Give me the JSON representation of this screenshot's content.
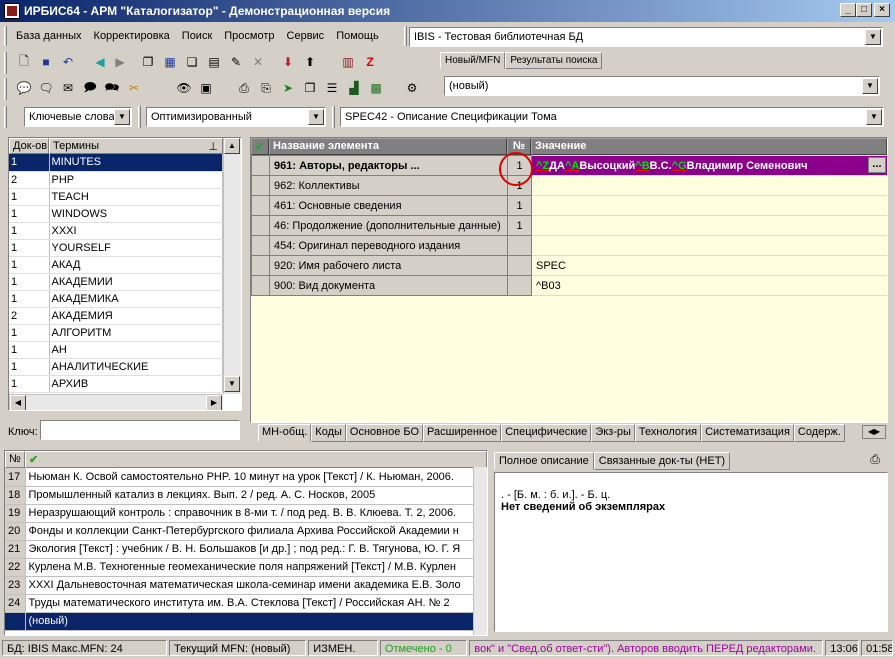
{
  "window": {
    "title": "ИРБИС64 - АРМ \"Каталогизатор\" - Демонстрационная версия",
    "controls": [
      "_",
      "□",
      "×"
    ]
  },
  "menu": [
    "База данных",
    "Корректировка",
    "Поиск",
    "Просмотр",
    "Сервис",
    "Помощь"
  ],
  "db_combo": "IBIS - Тестовая библиотечная БД",
  "right_tabs": [
    "Новый/MFN",
    "Результаты поиска"
  ],
  "record_combo": "(новый)",
  "search_bar": {
    "mode": "Ключевые слова",
    "worksheet": "Оптимизированный",
    "spec": "SPEC42 - Описание Спецификации Тома"
  },
  "terms": {
    "headers": [
      "Док-ов",
      "Термины"
    ],
    "rows": [
      [
        "1",
        "MINUTES"
      ],
      [
        "2",
        "PHP"
      ],
      [
        "1",
        "TEACH"
      ],
      [
        "1",
        "WINDOWS"
      ],
      [
        "1",
        "XXXI"
      ],
      [
        "1",
        "YOURSELF"
      ],
      [
        "1",
        "АКАД"
      ],
      [
        "1",
        "АКАДЕМИИ"
      ],
      [
        "1",
        "АКАДЕМИКА"
      ],
      [
        "2",
        "АКАДЕМИЯ"
      ],
      [
        "1",
        "АЛГОРИТМ"
      ],
      [
        "1",
        "АН"
      ],
      [
        "1",
        "АНАЛИТИЧЕСКИЕ"
      ],
      [
        "1",
        "АРХИВ"
      ]
    ],
    "key_label": "Ключ:",
    "key_value": ""
  },
  "editor": {
    "headers": [
      "Название элемента",
      "№",
      "Значение"
    ],
    "rows": [
      {
        "name": "961: Авторы, редакторы ...",
        "num": "1",
        "value": "",
        "selected": true
      },
      {
        "name": "962: Коллективы",
        "num": "1",
        "value": ""
      },
      {
        "name": "461: Основные сведения",
        "num": "1",
        "value": ""
      },
      {
        "name": "46: Продолжение (дополнительные данные)",
        "num": "1",
        "value": ""
      },
      {
        "name": "454: Оригинал переводного издания",
        "num": "",
        "value": ""
      },
      {
        "name": "920: Имя рабочего листа",
        "num": "",
        "value": "SPEC"
      },
      {
        "name": "900: Вид документа",
        "num": "",
        "value": "^B03"
      }
    ],
    "selected_value_parts": [
      {
        "text": "^Z",
        "hl": true
      },
      {
        "text": "ДА",
        "hl": false
      },
      {
        "text": "^A",
        "hl": true
      },
      {
        "text": "Высоцкий",
        "hl": false
      },
      {
        "text": "^B",
        "hl": true
      },
      {
        "text": "В.С.",
        "hl": false
      },
      {
        "text": "^G",
        "hl": true
      },
      {
        "text": "Владимир Семенович",
        "hl": false
      }
    ],
    "ellipsis": "..."
  },
  "editor_tabs": [
    "МН-общ.",
    "Коды",
    "Основное БО",
    "Расширенное",
    "Специфические",
    "Экз-ры",
    "Технология",
    "Систематизация",
    "Содерж."
  ],
  "doclist": {
    "headers": [
      "№",
      "✔"
    ],
    "rows": [
      [
        "17",
        "Ньюман К. Освой самостоятельно PHP. 10 минут на урок [Текст] / К. Ньюман, 2006."
      ],
      [
        "18",
        "Промышленный катализ в лекциях. Вып. 2 / ред. А. С. Носков, 2005"
      ],
      [
        "19",
        "Неразрушающий контроль : справочник в 8-ми т. / под ред. В. В. Клюева. Т. 2, 2006."
      ],
      [
        "20",
        "Фонды и коллекции Санкт-Петербургского филиала Архива Российской Академии н"
      ],
      [
        "21",
        "Экология [Текст] : учебник / В. Н. Большаков [и др.] ; под ред.: Г. В. Тягунова, Ю. Г. Я"
      ],
      [
        "22",
        "Курлена М.В. Техногенные геомеханические поля напряжений [Текст] / М.В. Курлен"
      ],
      [
        "23",
        "XXXI Дальневосточная математическая школа-семинар имени академика Е.В. Золо"
      ],
      [
        "24",
        "Труды математического института им. В.А. Стеклова [Текст] / Российская АН. № 2"
      ],
      [
        "",
        "(новый)"
      ]
    ]
  },
  "desc_tabs": [
    "Полное описание",
    "Связанные док-ты (НЕТ)"
  ],
  "description": {
    "line1": ". - [Б. м. : б. и.]. - Б. ц.",
    "line2": "Нет сведений об экземплярах"
  },
  "status": {
    "db": "БД: IBIS Макс.MFN: 24",
    "mfn": "Текущий MFN: (новый)",
    "changed": "ИЗМЕН.",
    "marked": "Отмечено - 0",
    "hint": "вок\" и \"Свед.об ответ-сти\"). Авторов вводить ПЕРЕД редакторами.",
    "time": "13:06",
    "clock": "01:58"
  }
}
